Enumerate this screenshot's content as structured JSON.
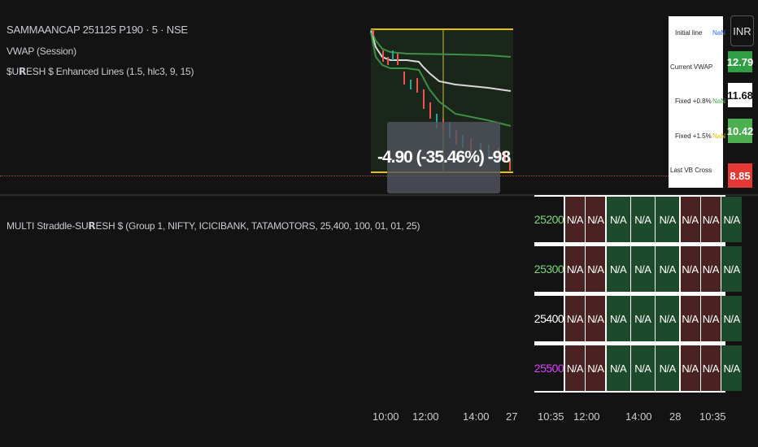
{
  "chart": {
    "title": "SAMMAANCAP 251125 P190 · 5 · NSE",
    "indicators": [
      {
        "label": "VWAP (Session)"
      },
      {
        "label": "$U𝗥ESH $ Enhanced Lines (1.5, hlc3, 9, 15)"
      }
    ],
    "tooltip": "-4.90 (-35.46%) -98",
    "currency_button": "INR"
  },
  "info_box": {
    "rows": [
      {
        "label": "Initial line",
        "value": "NaN",
        "value_color": "#2962ff"
      },
      {
        "label": "Current VWAP",
        "value": ""
      },
      {
        "label": "Fixed +0.8%",
        "value": "NaN",
        "value_color": "#4caf50"
      },
      {
        "label": "Fixed +1.5%",
        "value": "NaN",
        "value_color": "#e6c300"
      },
      {
        "label": "Last VB Cross",
        "value": ""
      }
    ]
  },
  "price_labels": [
    {
      "value": "12.79",
      "color": "#2ea043",
      "text_color": "#ffffff"
    },
    {
      "value": "11.68",
      "color": "#ffffff",
      "text_color": "#111111"
    },
    {
      "value": "10.42",
      "color": "#4caf50",
      "text_color": "#ffffff"
    },
    {
      "value": "8.85",
      "color": "#e53935",
      "text_color": "#ffffff"
    }
  ],
  "straddle": {
    "label": "MULTI Straddle-SU𝗥ESH $ (Group 1, NIFTY, ICICIBANK, TATAMOTORS, 25,400, 100, 01, 01, 25)",
    "rows": [
      {
        "strike": "25200",
        "strike_color": "#7cd67c",
        "cells": [
          "N/A",
          "N/A",
          "N/A",
          "N/A",
          "N/A",
          "N/A",
          "N/A",
          "N/A"
        ],
        "fills": [
          "red",
          "red",
          "green",
          "green",
          "green",
          "red",
          "red",
          "green"
        ]
      },
      {
        "strike": "25300",
        "strike_color": "#7cd67c",
        "cells": [
          "N/A",
          "N/A",
          "N/A",
          "N/A",
          "N/A",
          "N/A",
          "N/A",
          "N/A"
        ],
        "fills": [
          "red",
          "red",
          "green",
          "green",
          "green",
          "red",
          "red",
          "green"
        ]
      },
      {
        "strike": "25400",
        "strike_color": "#ffffff",
        "cells": [
          "N/A",
          "N/A",
          "N/A",
          "N/A",
          "N/A",
          "N/A",
          "N/A",
          "N/A"
        ],
        "fills": [
          "red",
          "red",
          "green",
          "green",
          "green",
          "red",
          "red",
          "green"
        ]
      },
      {
        "strike": "25500",
        "strike_color": "#e040fb",
        "cells": [
          "N/A",
          "N/A",
          "N/A",
          "N/A",
          "N/A",
          "N/A",
          "N/A",
          "N/A"
        ],
        "fills": [
          "red",
          "red",
          "green",
          "green",
          "green",
          "red",
          "red",
          "green"
        ]
      }
    ]
  },
  "time_axis": [
    "10:00",
    "12:00",
    "14:00",
    "27",
    "10:35",
    "12:00",
    "14:00",
    "28",
    "10:35"
  ]
}
